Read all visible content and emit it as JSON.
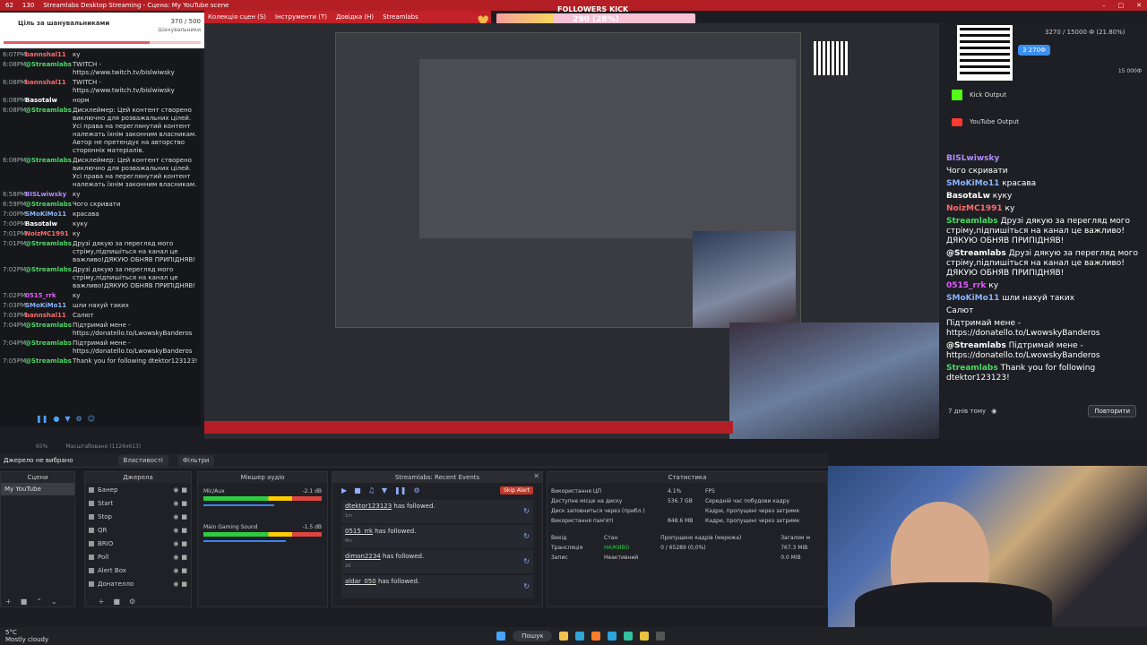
{
  "titlebar": {
    "cpu": "62",
    "count": "130",
    "title": "Streamlabs Desktop Streaming - Сцена: My YouTube scene"
  },
  "menu": {
    "items": [
      "Колекція сцен (S)",
      "Інструменти (T)",
      "Довідка (H)",
      "Streamlabs"
    ]
  },
  "goal": {
    "title": "Ціль за шанувальниками",
    "count": "370 / 500",
    "unit": "Шанувальники",
    "progress": 0.74
  },
  "followers_kick": {
    "label": "FOLLOWERS KICK",
    "value": "290 (28%)",
    "min": "0",
    "max": "1000",
    "progress": 0.29
  },
  "chat": {
    "messages": [
      {
        "time": "6:07PM",
        "name": "bannshal11",
        "color": "#ff6b6b",
        "text": "ку"
      },
      {
        "time": "6:08PM",
        "name": "@Streamlabs",
        "color": "#4cd964",
        "text": "TWITCH - https://www.twitch.tv/bislwiwsky"
      },
      {
        "time": "6:08PM",
        "name": "bannshal11",
        "color": "#ff6b6b",
        "text": "TWITCH - https://www.twitch.tv/bislwiwsky"
      },
      {
        "time": "6:08PM",
        "name": "Basotalw",
        "color": "#ffffff",
        "text": "норм"
      },
      {
        "time": "6:08PM",
        "name": "@Streamlabs",
        "color": "#4cd964",
        "text": "Дисклеймер: Цей контент створено виключно для розважальних цілей. Усі права на переглянутий контент належать їхнім законним власникам. Автор не претендує на авторство сторонніх матеріалів."
      },
      {
        "time": "6:08PM",
        "name": "@Streamlabs",
        "color": "#4cd964",
        "text": "Дисклеймер: Цей контент створено виключно для розважальних цілей. Усі права на переглянутий контент належать їхнім законним власникам."
      },
      {
        "time": "6:58PM",
        "name": "BISLwiwsky",
        "color": "#b28cff",
        "text": "ку"
      },
      {
        "time": "6:59PM",
        "name": "@Streamlabs",
        "color": "#4cd964",
        "text": "Чого скривати"
      },
      {
        "time": "7:00PM",
        "name": "SMoKiMo11",
        "color": "#8ab4ff",
        "text": "красава"
      },
      {
        "time": "7:00PM",
        "name": "Basotalw",
        "color": "#ffffff",
        "text": "куку"
      },
      {
        "time": "7:01PM",
        "name": "NoizMC1991",
        "color": "#ff6b6b",
        "text": "ку"
      },
      {
        "time": "7:01PM",
        "name": "@Streamlabs",
        "color": "#4cd964",
        "text": "Друзі дякую за перегляд мого стріму,підпишіться на канал це важливо!ДЯКУЮ ОБНЯВ ПРИПІДНЯВ!"
      },
      {
        "time": "7:02PM",
        "name": "@Streamlabs",
        "color": "#4cd964",
        "text": "Друзі дякую за перегляд мого стріму,підпишіться на канал це важливо!ДЯКУЮ ОБНЯВ ПРИПІДНЯВ!"
      },
      {
        "time": "7:02PM",
        "name": "0515_rrk",
        "color": "#e25bff",
        "text": "ку"
      },
      {
        "time": "7:03PM",
        "name": "SMoKiMo11",
        "color": "#8ab4ff",
        "text": "шли нахуй таких"
      },
      {
        "time": "7:03PM",
        "name": "bannshal11",
        "color": "#ff6b6b",
        "text": "Салют"
      },
      {
        "time": "7:04PM",
        "name": "@Streamlabs",
        "color": "#4cd964",
        "text": "Підтримай мене - https://donatello.to/LwowskyBanderos"
      },
      {
        "time": "7:04PM",
        "name": "@Streamlabs",
        "color": "#4cd964",
        "text": "Підтримай мене - https://donatello.to/LwowskyBanderos"
      },
      {
        "time": "7:05PM",
        "name": "@Streamlabs",
        "color": "#4cd964",
        "text": "Thank you for following dtektor123123!"
      }
    ]
  },
  "right_chat": {
    "goal_text": "3270 / 15000 Ф (21.80%)",
    "goal_badge": "3 270Ф",
    "goal_max": "15 000Ф",
    "kick_output": "Kick Output",
    "youtube_output": "YouTube Output",
    "messages": [
      {
        "name": "BISLwiwsky",
        "color": "#b28cff",
        "text": ""
      },
      {
        "name": "",
        "color": "#ffffff",
        "text": "Чого скривати"
      },
      {
        "name": "SMoKiMo11",
        "color": "#8ab4ff",
        "text": "красава"
      },
      {
        "name": "BasotaLw",
        "color": "#ffffff",
        "text": "куку"
      },
      {
        "name": "NoizMC1991",
        "color": "#ff6b6b",
        "text": "ку"
      },
      {
        "name": "Streamlabs",
        "color": "#4cd964",
        "text": "Друзі дякую за перегляд мого стріму,підпишіться на канал це важливо! ДЯКУЮ ОБНЯВ ПРИПІДНЯВ!"
      },
      {
        "name": "@Streamlabs",
        "color": "#ffffff",
        "text": "Друзі дякую за перегляд мого стріму,підпишіться на канал це важливо! ДЯКУЮ ОБНЯВ ПРИПІДНЯВ!"
      },
      {
        "name": "0515_rrk",
        "color": "#e25bff",
        "text": "ку"
      },
      {
        "name": "SMoKiMo11",
        "color": "#8ab4ff",
        "text": "шли нахуй таких"
      },
      {
        "name": "",
        "color": "#ffffff",
        "text": "Салют"
      },
      {
        "name": "",
        "color": "#ffffff",
        "text": "Підтримай мене - https://donatello.to/LwowskyBanderos"
      },
      {
        "name": "@Streamlabs",
        "color": "#ffffff",
        "text": "Підтримай мене - https://donatello.to/LwowskyBanderos"
      },
      {
        "name": "Streamlabs",
        "color": "#4cd964",
        "text": "Thank you for following dtektor123123!"
      }
    ],
    "footer_time": "7 днів тому",
    "retry": "Повторити"
  },
  "statusstrip": {
    "zoom": "65%",
    "scale": "Масштабовано (1124x613)"
  },
  "srcbar": {
    "no_source": "Джерело не вибрано",
    "properties": "Властивості",
    "filters": "Фільтри"
  },
  "scenes": {
    "title": "Сцени",
    "items": [
      "My YouTube"
    ]
  },
  "sources": {
    "title": "Джерела",
    "items": [
      "Банер",
      "Start",
      "Stop",
      "QR",
      "BRIO",
      "Poll",
      "Alert Box",
      "Донателло"
    ]
  },
  "mixer": {
    "title": "Мікшер аудіо",
    "channels": [
      {
        "name": "Mic/Aux",
        "db": "-2.1 dB",
        "level": 0.6
      },
      {
        "name": "Main Gaming Sound",
        "db": "-1.5 dB",
        "level": 0.7
      }
    ]
  },
  "events": {
    "title": "Streamlabs: Recent Events",
    "skip": "Skip Alert",
    "items": [
      {
        "who": "dtektor123123",
        "text": "has followed.",
        "ago": "1m"
      },
      {
        "who": "0515_rrk",
        "text": "has followed.",
        "ago": "6hr"
      },
      {
        "who": "dimon2234",
        "text": "has followed.",
        "ago": "2d"
      },
      {
        "who": "aldar_050",
        "text": "has followed.",
        "ago": ""
      }
    ]
  },
  "stats": {
    "title": "Статистика",
    "rows": [
      [
        "Використання ЦП",
        "4.1%",
        "FPS",
        ""
      ],
      [
        "Доступне місце на диску",
        "536.7 GB",
        "Середній час побудови кадру",
        ""
      ],
      [
        "Диск заповниться через (прибл.)",
        "",
        "Кадри, пропущені через затримк",
        ""
      ],
      [
        "Використання пам'яті",
        "848.6 MB",
        "Кадри, пропущені через затримк",
        ""
      ]
    ],
    "table_head": [
      "Вихід",
      "Стан",
      "Пропущено кадрів (мережа)",
      "Загалом м"
    ],
    "table_rows": [
      [
        "Трансляція",
        "НАЖИВО",
        "0 / 65289 (0,0%)",
        "767.3 MiB"
      ],
      [
        "Запис",
        "Неактивний",
        "",
        "0.0 MiB"
      ]
    ]
  },
  "taskbar": {
    "temp": "5°C",
    "weather": "Mostly cloudy",
    "search": "Пошук"
  }
}
